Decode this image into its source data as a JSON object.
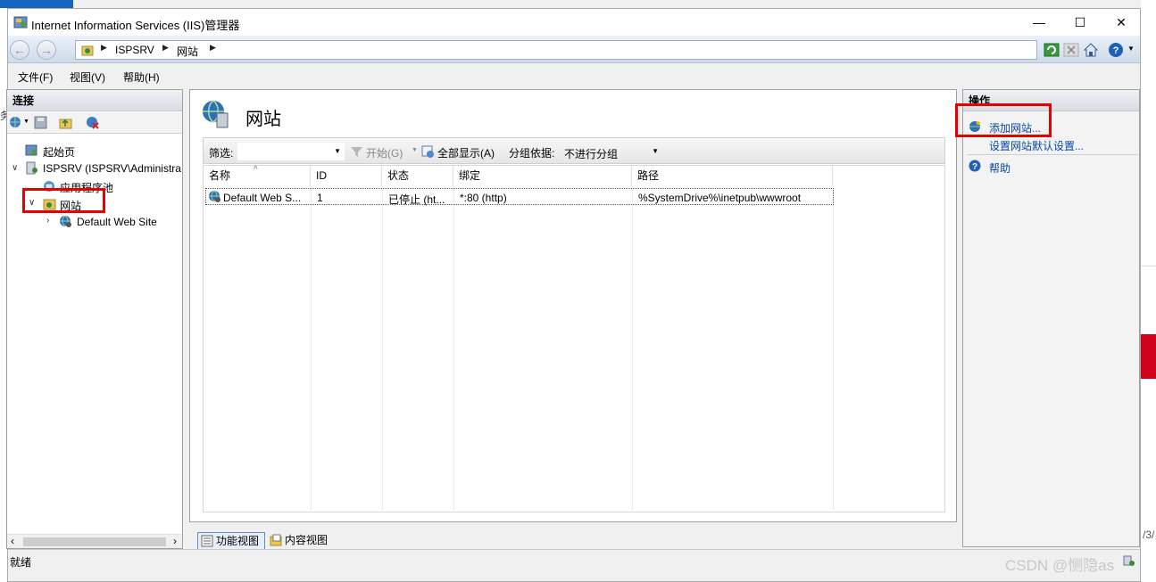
{
  "window": {
    "title": "Internet Information Services (IIS)管理器",
    "minimize": "—",
    "maximize": "☐",
    "close": "✕"
  },
  "nav": {
    "back": "←",
    "forward": "→",
    "breadcrumb": [
      "ISPSRV",
      "网站"
    ],
    "separator": "▶"
  },
  "menu": [
    "文件(F)",
    "视图(V)",
    "帮助(H)"
  ],
  "connections": {
    "header": "连接",
    "tree": {
      "start_page": "起始页",
      "server": "ISPSRV (ISPSRV\\Administra",
      "app_pools": "应用程序池",
      "sites": "网站",
      "default_site": "Default Web Site"
    }
  },
  "center": {
    "title": "网站",
    "filter_label": "筛选:",
    "start_label": "开始(G)",
    "show_all_label": "全部显示(A)",
    "group_label": "分组依据:",
    "group_value": "不进行分组",
    "columns": [
      "名称",
      "ID",
      "状态",
      "绑定",
      "路径"
    ],
    "rows": [
      {
        "name": "Default Web S...",
        "id": "1",
        "status": "已停止 (ht...",
        "binding": "*:80 (http)",
        "path": "%SystemDrive%\\inetpub\\wwwroot"
      }
    ],
    "feature_view": "功能视图",
    "content_view": "内容视图"
  },
  "actions": {
    "header": "操作",
    "add_site": "添加网站...",
    "site_defaults": "设置网站默认设置...",
    "help": "帮助"
  },
  "status": {
    "text": "就绪"
  },
  "background": {
    "left_char": "务",
    "right_text": "/3/",
    "watermark": "CSDN @恻隐as"
  },
  "colors": {
    "highlight_box": "#e60000",
    "link": "#0645ad"
  }
}
